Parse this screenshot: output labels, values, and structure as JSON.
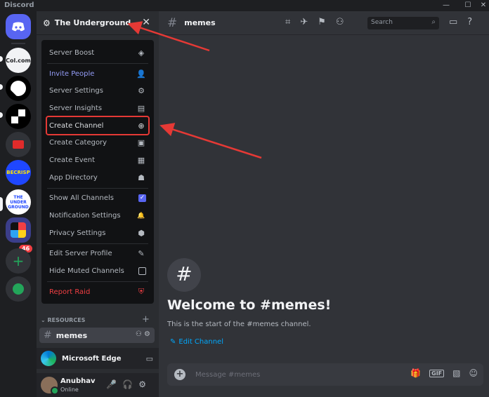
{
  "window": {
    "app_name": "Discord",
    "controls": [
      "—",
      "☐",
      "✕"
    ]
  },
  "guilds": {
    "items": [
      {
        "label": "",
        "kind": "home"
      },
      {
        "label": "Col.com",
        "kind": "server"
      },
      {
        "label": "",
        "kind": "server"
      },
      {
        "label": "",
        "kind": "server"
      },
      {
        "label": "",
        "kind": "server"
      },
      {
        "label": "BECRISP",
        "kind": "server"
      },
      {
        "label": "THE UNDER GROUND",
        "kind": "server"
      },
      {
        "label": "",
        "kind": "folder"
      }
    ],
    "folder_badge": "46",
    "add_server": "+",
    "explore": "✦"
  },
  "server": {
    "name": "The Underground",
    "close": "✕"
  },
  "menu": {
    "items": [
      {
        "label": "Server Boost",
        "icon": "◈",
        "style": ""
      },
      {
        "label": "Invite People",
        "icon": "👤",
        "style": "purple"
      },
      {
        "label": "Server Settings",
        "icon": "⚙",
        "style": ""
      },
      {
        "label": "Server Insights",
        "icon": "▤",
        "style": ""
      },
      {
        "label": "Create Channel",
        "icon": "⊕",
        "style": "hl"
      },
      {
        "label": "Create Category",
        "icon": "▣",
        "style": ""
      },
      {
        "label": "Create Event",
        "icon": "▦",
        "style": ""
      },
      {
        "label": "App Directory",
        "icon": "☗",
        "style": ""
      },
      {
        "label": "Show All Channels",
        "icon": "✓",
        "style": "check"
      },
      {
        "label": "Notification Settings",
        "icon": "🔔",
        "style": ""
      },
      {
        "label": "Privacy Settings",
        "icon": "⬢",
        "style": ""
      },
      {
        "label": "Edit Server Profile",
        "icon": "✎",
        "style": ""
      },
      {
        "label": "Hide Muted Channels",
        "icon": "",
        "style": "box"
      },
      {
        "label": "Report Raid",
        "icon": "⛨",
        "style": "red"
      }
    ]
  },
  "channels": {
    "category": "RESOURCES",
    "category_add": "+",
    "active": {
      "name": "memes",
      "icons": "⚇ ⚙"
    }
  },
  "activity": {
    "name": "Microsoft Edge",
    "icon": "▭"
  },
  "user": {
    "name": "Anubhav",
    "status": "Online",
    "icons": "🎤🎧⚙"
  },
  "topbar": {
    "channel": "memes",
    "icons": "⌗✈⚑⚇",
    "search_placeholder": "Search",
    "search_icon": "⌕",
    "right_icons": "▭?"
  },
  "welcome": {
    "title": "Welcome to #memes!",
    "subtitle": "This is the start of the #memes channel.",
    "edit": "Edit Channel"
  },
  "composer": {
    "placeholder": "Message #memes",
    "gif": "GIF"
  },
  "colors": {
    "accent": "#5865f2",
    "danger": "#f23f43",
    "annotation": "#e53935",
    "link": "#00a8fc"
  }
}
